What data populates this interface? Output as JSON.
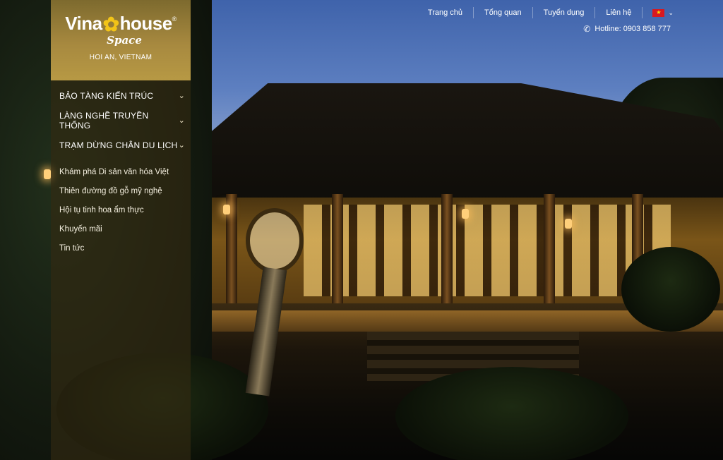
{
  "brand": {
    "logo_word1": "Vina",
    "logo_word2": "house",
    "logo_registered": "®",
    "logo_tagline": "Space",
    "location": "HOI AN, VIETNAM",
    "flower_icon": "flower-icon",
    "accent_color": "#f2c418"
  },
  "sidebar": {
    "main_items": [
      {
        "label": "BẢO TÀNG KIẾN TRÚC"
      },
      {
        "label": "LÀNG NGHỀ TRUYỀN THỐNG"
      },
      {
        "label": "TRẠM DỪNG CHÂN DU LỊCH"
      }
    ],
    "sub_items": [
      {
        "label": "Khám phá Di sản văn hóa Việt"
      },
      {
        "label": "Thiên đường đồ gỗ mỹ nghệ"
      },
      {
        "label": "Hội tụ tinh hoa ẩm thực"
      },
      {
        "label": "Khuyến mãi"
      },
      {
        "label": "Tin tức"
      }
    ]
  },
  "topnav": {
    "links": [
      {
        "label": "Trang chủ"
      },
      {
        "label": "Tổng quan"
      },
      {
        "label": "Tuyển dụng"
      },
      {
        "label": "Liên hệ"
      }
    ],
    "language": "vietnamese-flag-icon"
  },
  "hotline": {
    "text": "Hotline: 0903 858 777",
    "icon": "phone-icon"
  }
}
